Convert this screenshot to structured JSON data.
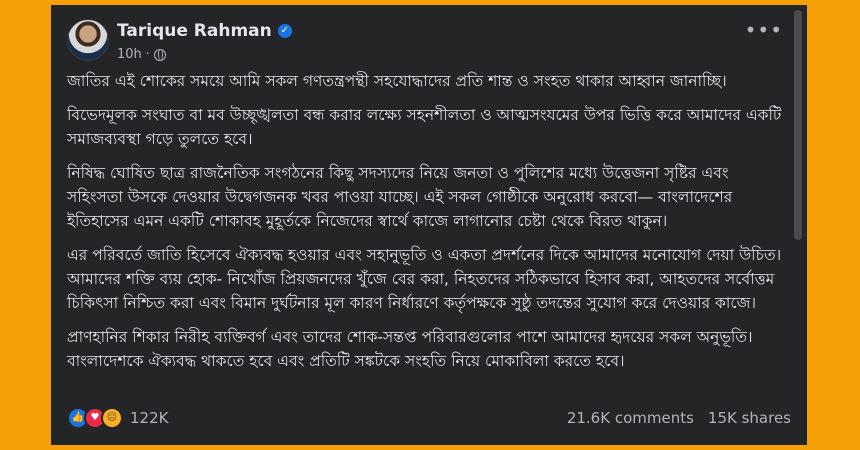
{
  "post": {
    "author": "Tarique Rahman",
    "time": "10h",
    "separator": "·",
    "more_label": "•••",
    "verified_icon": "verified-badge-icon",
    "privacy_icon": "globe-icon",
    "paragraphs": [
      "জাতির এই শোকের সময়ে আমি সকল গণতন্ত্রপন্থী সহযোদ্ধাদের প্রতি শান্ত ও সংহত থাকার আহ্বান জানাচ্ছি।",
      "বিভেদমূলক সংঘাত বা মব উচ্ছৃঙ্খলতা বন্ধ করার লক্ষ্যে সহনশীলতা ও আত্মসংযমের উপর ভিত্তি করে আমাদের একটি সমাজব্যবস্থা গড়ে তুলতে হবে।",
      "নিষিদ্ধ ঘোষিত ছাত্র রাজনৈতিক সংগঠনের কিছু সদস্যদের নিয়ে জনতা ও পুলিশের মধ্যে উত্তেজনা সৃষ্টির এবং সহিংসতা উসকে দেওয়ার উদ্বেগজনক খবর পাওয়া যাচ্ছে। এই সকল গোষ্ঠীকে অনুরোধ করবো— বাংলাদেশের ইতিহাসের এমন একটি শোকাবহ মুহূর্তকে নিজেদের স্বার্থে কাজে লাগানোর চেষ্টা থেকে বিরত থাকুন।",
      "এর পরিবর্তে জাতি হিসেবে ঐক্যবদ্ধ হওয়ার এবং সহানুভূতি ও একতা প্রদর্শনের দিকে আমাদের মনোযোগ দেয়া উচিত। আমাদের শক্তি ব্যয় হোক- নিখোঁজ প্রিয়জনদের খুঁজে বের করা, নিহতদের সঠিকভাবে হিসাব করা, আহতদের সর্বোত্তম চিকিৎসা নিশ্চিত করা এবং বিমান দুর্ঘটনার মূল কারণ নির্ধারণে কর্তৃপক্ষকে সুষ্ঠু তদন্তের সুযোগ করে দেওয়ার কাজে।",
      "প্রাণহানির শিকার নিরীহ ব্যক্তিবর্গ এবং তাদের শোক-সন্তপ্ত পরিবারগুলোর পাশে আমাদের হৃদয়ের সকল অনুভূতি। বাংলাদেশকে ঐক্যবদ্ধ থাকতে হবে এবং প্রতিটি সঙ্কটকে সংহতি নিয়ে মোকাবিলা করতে হবে।"
    ]
  },
  "footer": {
    "reaction_icons": [
      "like-icon",
      "love-icon",
      "sad-icon"
    ],
    "reactions_count": "122K",
    "comments": "21.6K comments",
    "shares": "15K shares"
  },
  "colors": {
    "background": "#f5a006",
    "card": "#242526",
    "text": "#e4e6eb",
    "secondary": "#b0b3b8",
    "verified": "#1b74e4"
  }
}
